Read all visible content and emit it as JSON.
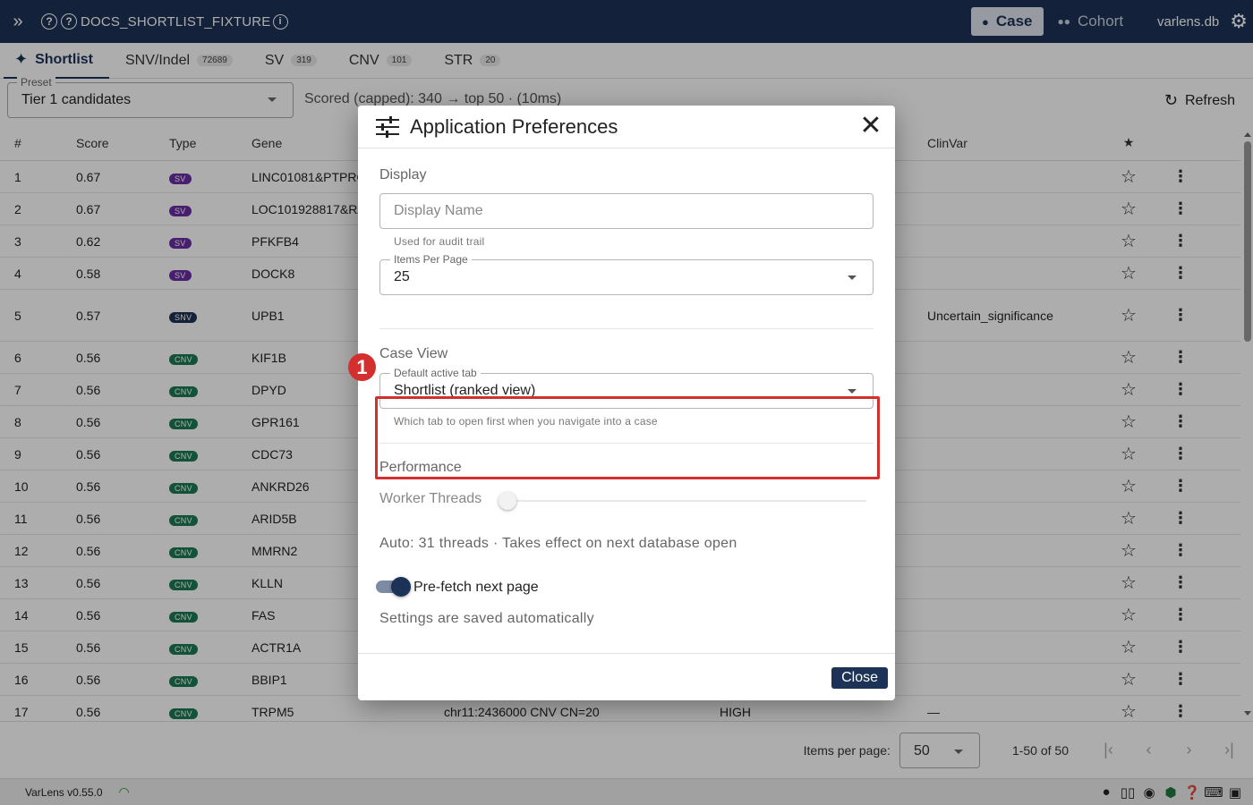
{
  "topbar": {
    "db_name": "DOCS_SHORTLIST_FIXTURE",
    "case_label": "Case",
    "cohort_label": "Cohort",
    "user_db": "varlens.db"
  },
  "tabs": [
    {
      "label": "Shortlist",
      "badge": ""
    },
    {
      "label": "SNV/Indel",
      "badge": "72689"
    },
    {
      "label": "SV",
      "badge": "319"
    },
    {
      "label": "CNV",
      "badge": "101"
    },
    {
      "label": "STR",
      "badge": "20"
    }
  ],
  "preset": {
    "legend": "Preset",
    "value": "Tier 1 candidates"
  },
  "scored_text": "Scored (capped): 340 → top 50 · (10ms)",
  "refresh_label": "Refresh",
  "table": {
    "headers": {
      "num": "#",
      "score": "Score",
      "type": "Type",
      "gene": "Gene",
      "clinvar": "ClinVar",
      "star": "★"
    },
    "rows": [
      {
        "num": "1",
        "score": "0.67",
        "type": "SV",
        "gene": "LINC01081&PTPRQ",
        "loc": "",
        "imp": "",
        "clin": ""
      },
      {
        "num": "2",
        "score": "0.67",
        "type": "SV",
        "gene": "LOC101928817&RAB",
        "loc": "",
        "imp": "",
        "clin": ""
      },
      {
        "num": "3",
        "score": "0.62",
        "type": "SV",
        "gene": "PFKFB4",
        "loc": "",
        "imp": "",
        "clin": ""
      },
      {
        "num": "4",
        "score": "0.58",
        "type": "SV",
        "gene": "DOCK8",
        "loc": "",
        "imp": "",
        "clin": ""
      },
      {
        "num": "5",
        "score": "0.57",
        "type": "SNV",
        "gene": "UPB1",
        "loc": "",
        "imp": "",
        "clin": "Uncertain_significance"
      },
      {
        "num": "6",
        "score": "0.56",
        "type": "CNV",
        "gene": "KIF1B",
        "loc": "",
        "imp": "",
        "clin": ""
      },
      {
        "num": "7",
        "score": "0.56",
        "type": "CNV",
        "gene": "DPYD",
        "loc": "",
        "imp": "",
        "clin": ""
      },
      {
        "num": "8",
        "score": "0.56",
        "type": "CNV",
        "gene": "GPR161",
        "loc": "",
        "imp": "",
        "clin": ""
      },
      {
        "num": "9",
        "score": "0.56",
        "type": "CNV",
        "gene": "CDC73",
        "loc": "",
        "imp": "",
        "clin": ""
      },
      {
        "num": "10",
        "score": "0.56",
        "type": "CNV",
        "gene": "ANKRD26",
        "loc": "",
        "imp": "",
        "clin": ""
      },
      {
        "num": "11",
        "score": "0.56",
        "type": "CNV",
        "gene": "ARID5B",
        "loc": "",
        "imp": "",
        "clin": ""
      },
      {
        "num": "12",
        "score": "0.56",
        "type": "CNV",
        "gene": "MMRN2",
        "loc": "",
        "imp": "",
        "clin": ""
      },
      {
        "num": "13",
        "score": "0.56",
        "type": "CNV",
        "gene": "KLLN",
        "loc": "",
        "imp": "",
        "clin": ""
      },
      {
        "num": "14",
        "score": "0.56",
        "type": "CNV",
        "gene": "FAS",
        "loc": "",
        "imp": "",
        "clin": ""
      },
      {
        "num": "15",
        "score": "0.56",
        "type": "CNV",
        "gene": "ACTR1A",
        "loc": "",
        "imp": "",
        "clin": ""
      },
      {
        "num": "16",
        "score": "0.56",
        "type": "CNV",
        "gene": "BBIP1",
        "loc": "",
        "imp": "",
        "clin": ""
      },
      {
        "num": "17",
        "score": "0.56",
        "type": "CNV",
        "gene": "TRPM5",
        "loc": "chr11:2436000 CNV CN=20",
        "imp": "HIGH",
        "clin": "—"
      }
    ]
  },
  "pager": {
    "items_per_page_label": "Items per page:",
    "items_per_page_value": "50",
    "range": "1-50 of 50"
  },
  "status": {
    "version": "VarLens v0.55.0"
  },
  "modal": {
    "title": "Application Preferences",
    "display_section": "Display",
    "display_name_placeholder": "Display Name",
    "display_name_helper": "Used for audit trail",
    "items_per_page_legend": "Items Per Page",
    "items_per_page_value": "25",
    "case_view_section": "Case View",
    "default_tab_legend": "Default active tab",
    "default_tab_value": "Shortlist (ranked view)",
    "default_tab_helper": "Which tab to open first when you navigate into a case",
    "performance_section": "Performance",
    "worker_threads_label": "Worker Threads",
    "worker_threads_level": 0,
    "auto_threads_text": "Auto: 31 threads · Takes effect on next database open",
    "prefetch_label": "Pre-fetch next page",
    "prefetch_enabled": true,
    "saved_text": "Settings are saved automatically",
    "close_label": "Close",
    "marker_number": "1"
  },
  "colors": {
    "navy": "#1c3256",
    "highlight_red": "#d32f2f",
    "sv_purple": "#6a2fa6",
    "cnv_green": "#1a7a55"
  }
}
